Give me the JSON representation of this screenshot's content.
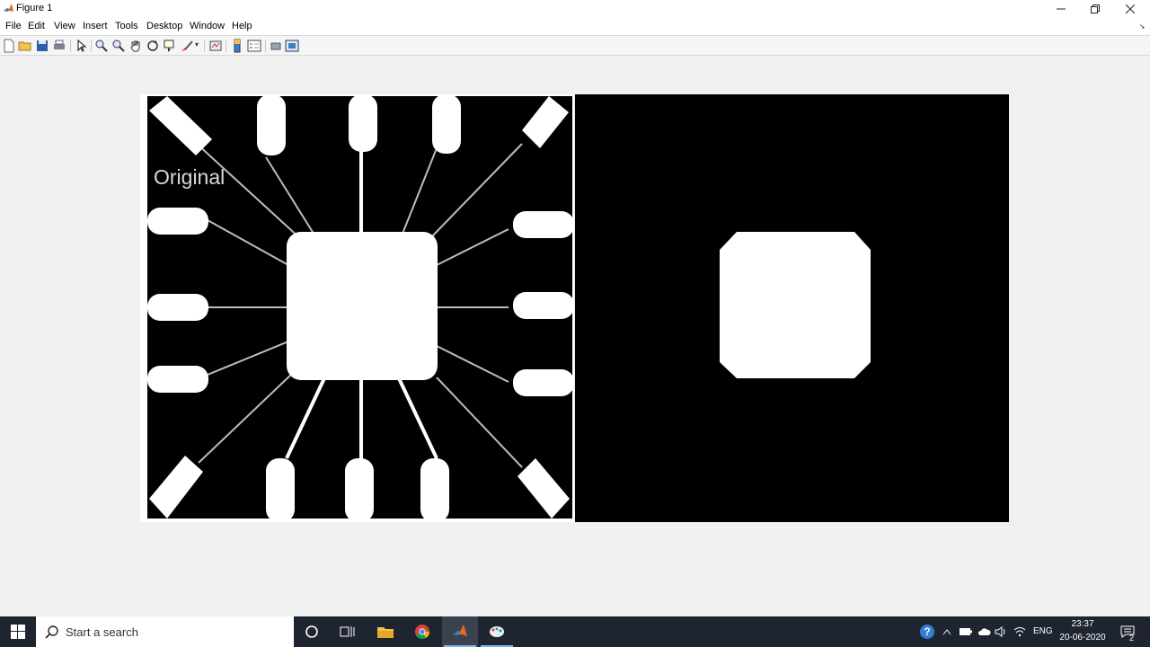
{
  "window": {
    "title": "Figure 1",
    "controls": {
      "minimize": "—",
      "restore": "❐",
      "close": "✕"
    }
  },
  "menu": [
    "File",
    "Edit",
    "View",
    "Insert",
    "Tools",
    "Desktop",
    "Window",
    "Help"
  ],
  "toolbar": {
    "buttons": [
      "new-figure-icon",
      "open-file-icon",
      "save-icon",
      "print-icon",
      "edit-plot-arrow-icon",
      "zoom-in-icon",
      "zoom-out-icon",
      "pan-hand-icon",
      "rotate-3d-icon",
      "data-cursor-icon",
      "brush-icon",
      "link-plot-icon",
      "insert-colorbar-icon",
      "insert-legend-icon",
      "hide-plot-tools-icon",
      "show-plot-tools-icon"
    ]
  },
  "figure": {
    "left_label": "Original"
  },
  "taskbar": {
    "search_placeholder": "Start a search",
    "language": "ENG",
    "time": "23:37",
    "date": "20-06-2020",
    "notifications": "2"
  },
  "colors": {
    "window_bg": "#f0f0f0",
    "taskbar_bg": "#1e2530",
    "matlab_orange": "#e36b1e",
    "taskbar_accent": "#7db4e8"
  }
}
